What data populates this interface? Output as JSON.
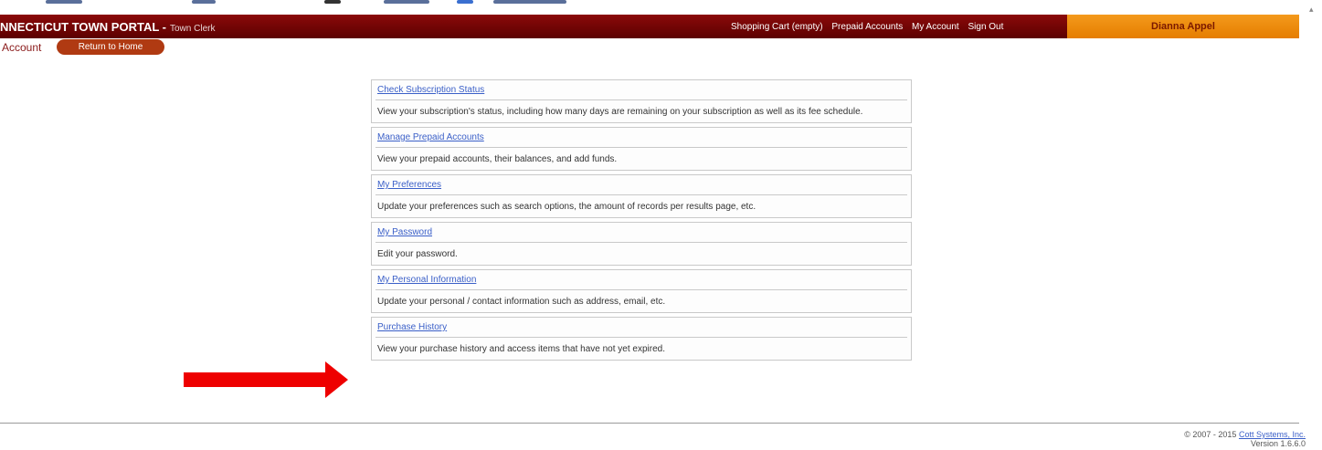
{
  "header": {
    "title": "NNECTICUT TOWN PORTAL -",
    "subtitle": "Town Clerk",
    "nav": [
      "Shopping Cart (empty)",
      "Prepaid Accounts",
      "My Account",
      "Sign Out"
    ],
    "user_name": "Dianna Appel"
  },
  "subbar": {
    "account_label": "Account",
    "home_button": "Return to Home"
  },
  "menu": [
    {
      "link": "Check Subscription Status",
      "description": "View your subscription's status, including how many days are remaining on your subscription as well as its fee schedule."
    },
    {
      "link": "Manage Prepaid Accounts",
      "description": "View your prepaid accounts, their balances, and add funds."
    },
    {
      "link": "My Preferences",
      "description": "Update your preferences such as search options, the amount of records per results page, etc."
    },
    {
      "link": "My Password",
      "description": "Edit your password."
    },
    {
      "link": "My Personal Information",
      "description": "Update your personal / contact information such as address, email, etc."
    },
    {
      "link": "Purchase History",
      "description": "View your purchase history and access items that have not yet expired."
    }
  ],
  "footer": {
    "copyright": "© 2007 - 2015",
    "company_link": "Cott Systems, Inc.",
    "version": "Version 1.6.6.0"
  },
  "annotation": {
    "arrow_color": "#ee0000",
    "points_to": "Purchase History"
  },
  "colors": {
    "header_bg": "#6e0505",
    "user_box_bg": "#f08c10",
    "link": "#3a5fc8"
  }
}
